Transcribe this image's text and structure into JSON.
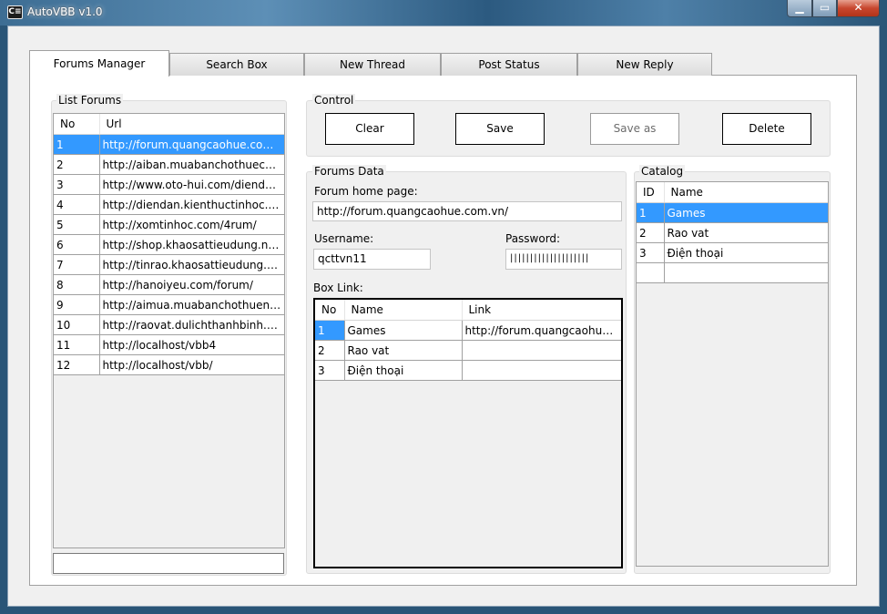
{
  "window": {
    "title": "AutoVBB v1.0",
    "app_icon_text": "C≡",
    "min_glyph": "▁",
    "max_glyph": "▭",
    "close_glyph": "✕"
  },
  "tabs": [
    {
      "label": "Forums Manager",
      "active": true
    },
    {
      "label": "Search Box"
    },
    {
      "label": "New Thread"
    },
    {
      "label": "Post Status"
    },
    {
      "label": "New Reply"
    }
  ],
  "list_forums": {
    "title": "List Forums",
    "columns": [
      "No",
      "Url"
    ],
    "rows": [
      {
        "no": "1",
        "url": "http://forum.quangcaohue.com.vn/",
        "selected": true
      },
      {
        "no": "2",
        "url": "http://aiban.muabanchothuecanho.com/"
      },
      {
        "no": "3",
        "url": "http://www.oto-hui.com/diendan/"
      },
      {
        "no": "4",
        "url": "http://diendan.kienthuctinhoc.net/"
      },
      {
        "no": "5",
        "url": "http://xomtinhoc.com/4rum/"
      },
      {
        "no": "6",
        "url": "http://shop.khaosattieudung.net/"
      },
      {
        "no": "7",
        "url": "http://tinrao.khaosattieudung.com/"
      },
      {
        "no": "8",
        "url": "http://hanoiyeu.com/forum/"
      },
      {
        "no": "9",
        "url": "http://aimua.muabanchothuenhadat.com/"
      },
      {
        "no": "10",
        "url": "http://raovat.dulichthanhbinh.net/"
      },
      {
        "no": "11",
        "url": "http://localhost/vbb4"
      },
      {
        "no": "12",
        "url": "http://localhost/vbb/"
      }
    ],
    "bottom_input_value": ""
  },
  "control": {
    "title": "Control",
    "clear_label": "Clear",
    "save_label": "Save",
    "save_as_label": "Save as",
    "delete_label": "Delete"
  },
  "forums_data": {
    "title": "Forums Data",
    "home_page_label": "Forum home page:",
    "home_page_value": "http://forum.quangcaohue.com.vn/",
    "username_label": "Username:",
    "username_value": "qcttvn11",
    "password_label": "Password:",
    "password_value": "||||||||||||||||||||",
    "box_link_label": "Box Link:",
    "box_link_columns": [
      "No",
      "Name",
      "Link"
    ],
    "box_link_rows": [
      {
        "no": "1",
        "name": "Games",
        "link": "http://forum.quangcaohue.com.vn/",
        "selected": true
      },
      {
        "no": "2",
        "name": "Rao vat",
        "link": ""
      },
      {
        "no": "3",
        "name": "Điện thoại",
        "link": ""
      }
    ]
  },
  "catalog": {
    "title": "Catalog",
    "columns": [
      "ID",
      "Name"
    ],
    "rows": [
      {
        "id": "1",
        "name": "Games",
        "selected": true
      },
      {
        "id": "2",
        "name": "Rao vat"
      },
      {
        "id": "3",
        "name": "Điện thoại"
      }
    ]
  }
}
